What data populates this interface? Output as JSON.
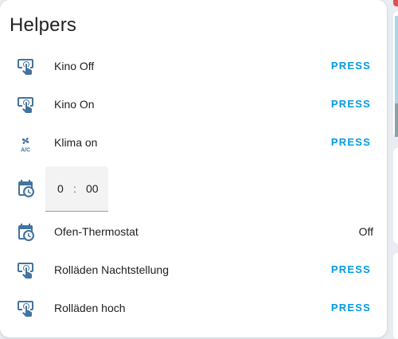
{
  "card": {
    "title": "Helpers"
  },
  "colors": {
    "icon": "#44739e",
    "accent": "#039be5"
  },
  "rows": [
    {
      "icon": "gesture-tap-button-icon",
      "label": "Kino Off",
      "action": "PRESS"
    },
    {
      "icon": "gesture-tap-button-icon",
      "label": "Kino On",
      "action": "PRESS"
    },
    {
      "icon": "air-conditioner-icon",
      "label": "Klima on",
      "action": "PRESS"
    },
    {
      "icon": "calendar-clock-icon",
      "time": {
        "hours": "0",
        "separator": ":",
        "minutes": "00"
      }
    },
    {
      "icon": "calendar-clock-icon",
      "label": "Ofen-Thermostat",
      "state": "Off"
    },
    {
      "icon": "gesture-tap-button-icon",
      "label": "Rolläden Nachtstellung",
      "action": "PRESS"
    },
    {
      "icon": "gesture-tap-button-icon",
      "label": "Rolläden hoch",
      "action": "PRESS"
    }
  ]
}
